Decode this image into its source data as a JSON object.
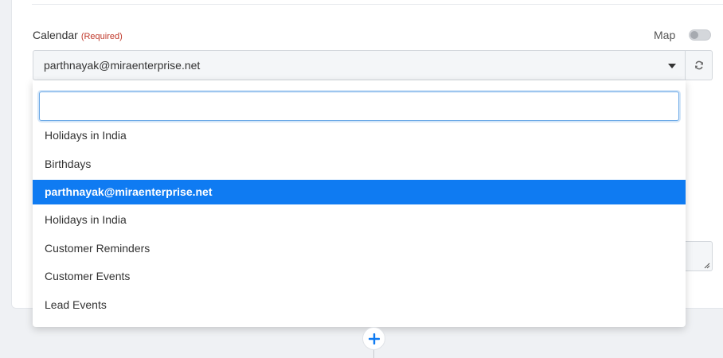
{
  "field": {
    "label": "Calendar",
    "required_text": "(Required)",
    "selected_value": "parthnayak@miraenterprise.net",
    "map_label": "Map"
  },
  "dropdown": {
    "search_value": "",
    "options": [
      {
        "label": "Holidays in India"
      },
      {
        "label": "Birthdays"
      },
      {
        "label": "parthnayak@miraenterprise.net",
        "selected": true
      },
      {
        "label": "Holidays in India"
      },
      {
        "label": "Customer Reminders"
      },
      {
        "label": "Customer Events"
      },
      {
        "label": "Lead Events"
      }
    ]
  },
  "colors": {
    "accent": "#0f7bf2",
    "required": "#c0392b"
  },
  "icons": {
    "refresh": "refresh-icon",
    "caret": "caret-down-icon",
    "add": "plus-icon",
    "resize": "resize-handle-icon"
  }
}
